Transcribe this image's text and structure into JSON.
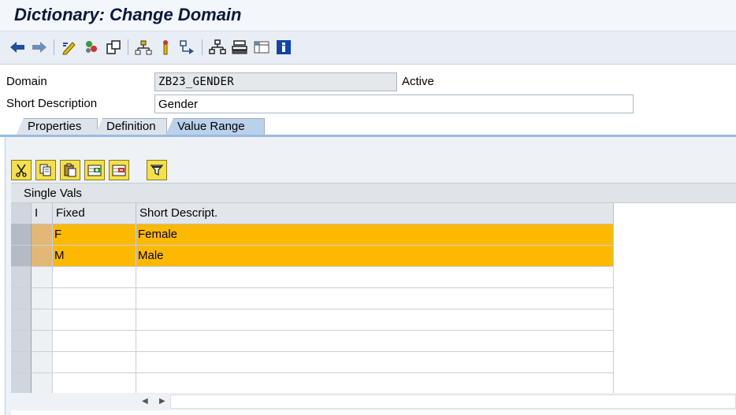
{
  "window": {
    "title": "Dictionary: Change Domain"
  },
  "toolbar": {
    "icons": [
      "back-arrow-icon",
      "forward-arrow-icon",
      "edit-pencil-icon",
      "activate-icon",
      "other-object-icon",
      "where-used-icon",
      "display-object-list-icon",
      "hierarchy-icon",
      "hierarchy-2-icon",
      "layout-icon",
      "info-icon"
    ]
  },
  "form": {
    "domain_label": "Domain",
    "domain_value": "ZB23_GENDER",
    "status": "Active",
    "short_desc_label": "Short Description",
    "short_desc_value": "Gender"
  },
  "tabs": [
    {
      "label": "Properties"
    },
    {
      "label": "Definition"
    },
    {
      "label": "Value Range",
      "active": true
    }
  ],
  "value_table": {
    "toolbar_icons": [
      "cut-icon",
      "copy-icon",
      "paste-icon",
      "insert-row-icon",
      "delete-row-icon",
      "filter-icon"
    ],
    "section_title": "Single Vals",
    "columns": [
      "I",
      "Fixed",
      "Short Descript."
    ],
    "rows": [
      {
        "fixed": "F",
        "desc": "Female"
      },
      {
        "fixed": "M",
        "desc": "Male"
      }
    ],
    "highlight_color": "#fdb900"
  }
}
